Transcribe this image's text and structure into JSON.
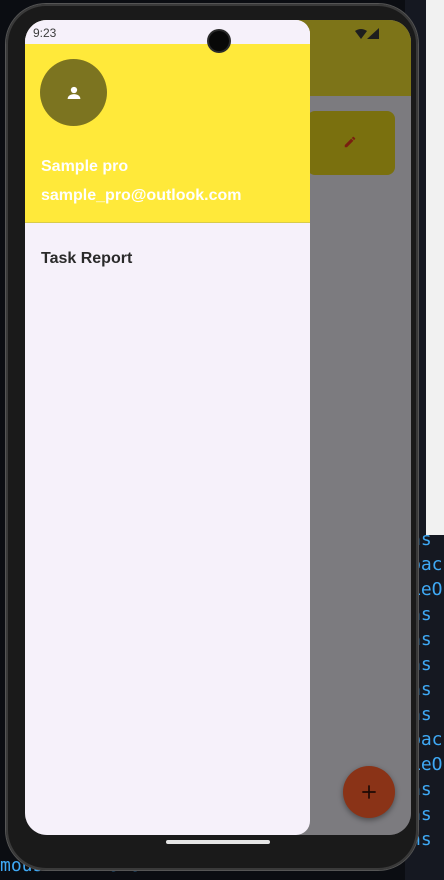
{
  "status_bar": {
    "time": "9:23"
  },
  "drawer": {
    "account_name": "Sample pro",
    "account_email": "sample_pro@outlook.com",
    "menu_items": [
      {
        "label": "Task Report"
      }
    ]
  },
  "colors": {
    "header_bg": "#ffe93a",
    "drawer_bg": "#f6f1fa",
    "avatar_bg": "#7c7420",
    "fab_bg": "#8a3317",
    "scrim": "#7c7b7f"
  },
  "icons": {
    "avatar": "person-icon",
    "fab": "plus-icon",
    "card_action": "edit-icon"
  },
  "background_code": {
    "lines": [
      "ns r",
      "back",
      "LeOn",
      "ns r",
      "ns r",
      "ns r",
      "ns r",
      "ns r",
      "back",
      "LeOn",
      "ns r",
      "ns r",
      "ns r"
    ],
    "bottom": "mous r                 r                  rsms r"
  }
}
